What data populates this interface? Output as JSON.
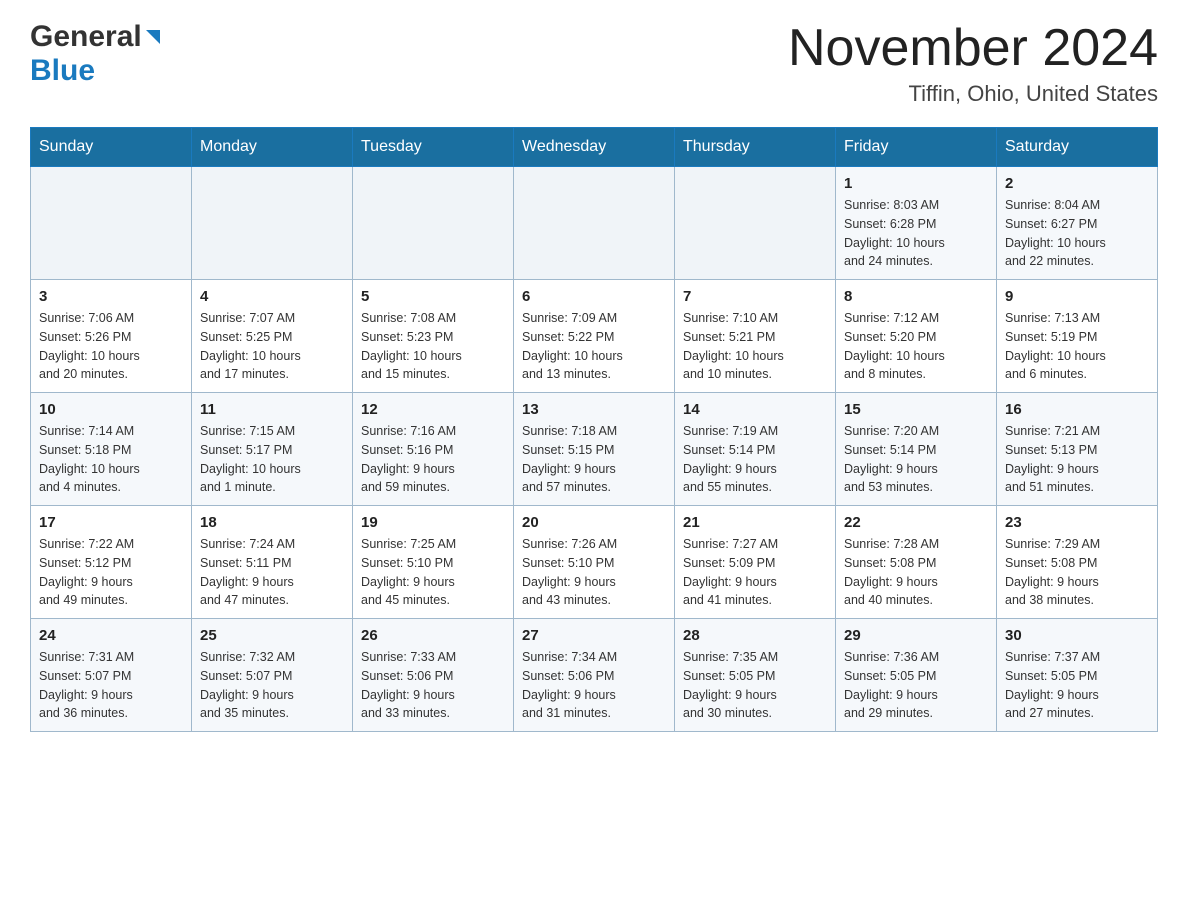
{
  "header": {
    "logo_general": "General",
    "logo_blue": "Blue",
    "month_title": "November 2024",
    "location": "Tiffin, Ohio, United States"
  },
  "days_of_week": [
    "Sunday",
    "Monday",
    "Tuesday",
    "Wednesday",
    "Thursday",
    "Friday",
    "Saturday"
  ],
  "weeks": [
    [
      {
        "day": "",
        "info": ""
      },
      {
        "day": "",
        "info": ""
      },
      {
        "day": "",
        "info": ""
      },
      {
        "day": "",
        "info": ""
      },
      {
        "day": "",
        "info": ""
      },
      {
        "day": "1",
        "info": "Sunrise: 8:03 AM\nSunset: 6:28 PM\nDaylight: 10 hours\nand 24 minutes."
      },
      {
        "day": "2",
        "info": "Sunrise: 8:04 AM\nSunset: 6:27 PM\nDaylight: 10 hours\nand 22 minutes."
      }
    ],
    [
      {
        "day": "3",
        "info": "Sunrise: 7:06 AM\nSunset: 5:26 PM\nDaylight: 10 hours\nand 20 minutes."
      },
      {
        "day": "4",
        "info": "Sunrise: 7:07 AM\nSunset: 5:25 PM\nDaylight: 10 hours\nand 17 minutes."
      },
      {
        "day": "5",
        "info": "Sunrise: 7:08 AM\nSunset: 5:23 PM\nDaylight: 10 hours\nand 15 minutes."
      },
      {
        "day": "6",
        "info": "Sunrise: 7:09 AM\nSunset: 5:22 PM\nDaylight: 10 hours\nand 13 minutes."
      },
      {
        "day": "7",
        "info": "Sunrise: 7:10 AM\nSunset: 5:21 PM\nDaylight: 10 hours\nand 10 minutes."
      },
      {
        "day": "8",
        "info": "Sunrise: 7:12 AM\nSunset: 5:20 PM\nDaylight: 10 hours\nand 8 minutes."
      },
      {
        "day": "9",
        "info": "Sunrise: 7:13 AM\nSunset: 5:19 PM\nDaylight: 10 hours\nand 6 minutes."
      }
    ],
    [
      {
        "day": "10",
        "info": "Sunrise: 7:14 AM\nSunset: 5:18 PM\nDaylight: 10 hours\nand 4 minutes."
      },
      {
        "day": "11",
        "info": "Sunrise: 7:15 AM\nSunset: 5:17 PM\nDaylight: 10 hours\nand 1 minute."
      },
      {
        "day": "12",
        "info": "Sunrise: 7:16 AM\nSunset: 5:16 PM\nDaylight: 9 hours\nand 59 minutes."
      },
      {
        "day": "13",
        "info": "Sunrise: 7:18 AM\nSunset: 5:15 PM\nDaylight: 9 hours\nand 57 minutes."
      },
      {
        "day": "14",
        "info": "Sunrise: 7:19 AM\nSunset: 5:14 PM\nDaylight: 9 hours\nand 55 minutes."
      },
      {
        "day": "15",
        "info": "Sunrise: 7:20 AM\nSunset: 5:14 PM\nDaylight: 9 hours\nand 53 minutes."
      },
      {
        "day": "16",
        "info": "Sunrise: 7:21 AM\nSunset: 5:13 PM\nDaylight: 9 hours\nand 51 minutes."
      }
    ],
    [
      {
        "day": "17",
        "info": "Sunrise: 7:22 AM\nSunset: 5:12 PM\nDaylight: 9 hours\nand 49 minutes."
      },
      {
        "day": "18",
        "info": "Sunrise: 7:24 AM\nSunset: 5:11 PM\nDaylight: 9 hours\nand 47 minutes."
      },
      {
        "day": "19",
        "info": "Sunrise: 7:25 AM\nSunset: 5:10 PM\nDaylight: 9 hours\nand 45 minutes."
      },
      {
        "day": "20",
        "info": "Sunrise: 7:26 AM\nSunset: 5:10 PM\nDaylight: 9 hours\nand 43 minutes."
      },
      {
        "day": "21",
        "info": "Sunrise: 7:27 AM\nSunset: 5:09 PM\nDaylight: 9 hours\nand 41 minutes."
      },
      {
        "day": "22",
        "info": "Sunrise: 7:28 AM\nSunset: 5:08 PM\nDaylight: 9 hours\nand 40 minutes."
      },
      {
        "day": "23",
        "info": "Sunrise: 7:29 AM\nSunset: 5:08 PM\nDaylight: 9 hours\nand 38 minutes."
      }
    ],
    [
      {
        "day": "24",
        "info": "Sunrise: 7:31 AM\nSunset: 5:07 PM\nDaylight: 9 hours\nand 36 minutes."
      },
      {
        "day": "25",
        "info": "Sunrise: 7:32 AM\nSunset: 5:07 PM\nDaylight: 9 hours\nand 35 minutes."
      },
      {
        "day": "26",
        "info": "Sunrise: 7:33 AM\nSunset: 5:06 PM\nDaylight: 9 hours\nand 33 minutes."
      },
      {
        "day": "27",
        "info": "Sunrise: 7:34 AM\nSunset: 5:06 PM\nDaylight: 9 hours\nand 31 minutes."
      },
      {
        "day": "28",
        "info": "Sunrise: 7:35 AM\nSunset: 5:05 PM\nDaylight: 9 hours\nand 30 minutes."
      },
      {
        "day": "29",
        "info": "Sunrise: 7:36 AM\nSunset: 5:05 PM\nDaylight: 9 hours\nand 29 minutes."
      },
      {
        "day": "30",
        "info": "Sunrise: 7:37 AM\nSunset: 5:05 PM\nDaylight: 9 hours\nand 27 minutes."
      }
    ]
  ]
}
